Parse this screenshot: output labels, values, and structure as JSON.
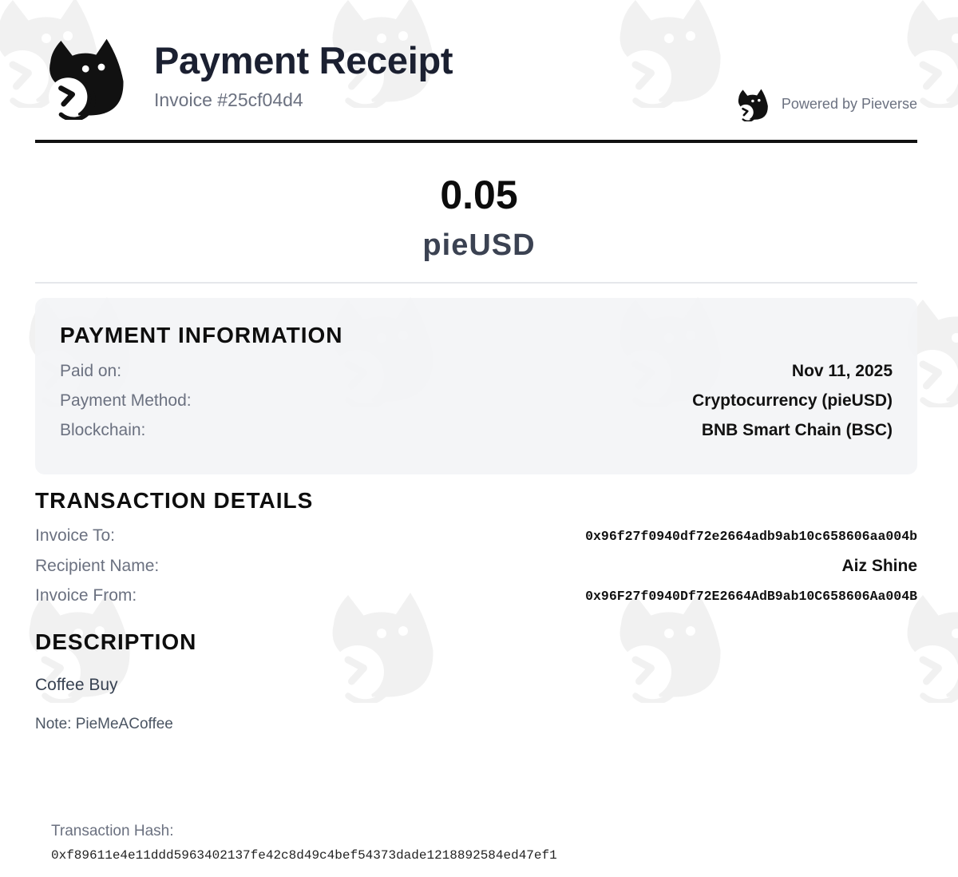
{
  "header": {
    "title": "Payment Receipt",
    "invoice_number": "Invoice #25cf04d4",
    "powered_by": "Powered by Pieverse"
  },
  "amount": {
    "value": "0.05",
    "currency": "pieUSD"
  },
  "payment_information": {
    "title": "PAYMENT INFORMATION",
    "rows": [
      {
        "label": "Paid on:",
        "value": "Nov 11, 2025"
      },
      {
        "label": "Payment Method:",
        "value": "Cryptocurrency (pieUSD)"
      },
      {
        "label": "Blockchain:",
        "value": "BNB Smart Chain (BSC)"
      }
    ]
  },
  "transaction_details": {
    "title": "TRANSACTION DETAILS",
    "rows": [
      {
        "label": "Invoice To:",
        "value": "0x96f27f0940df72e2664adb9ab10c658606aa004b"
      },
      {
        "label": "Recipient Name:",
        "value": "Aiz Shine"
      },
      {
        "label": "Invoice From:",
        "value": "0x96F27f0940Df72E2664AdB9ab10C658606Aa004B"
      }
    ]
  },
  "description": {
    "title": "DESCRIPTION",
    "text": "Coffee Buy",
    "note": "Note: PieMeACoffee"
  },
  "transaction_hash": {
    "label": "Transaction Hash:",
    "value": "0xf89611e4e11ddd5963402137fe42c8d49c4bef54373dade1218892584ed47ef1"
  },
  "icons": {
    "brand_logo": "pieverse-cat-logo-icon",
    "powered_logo": "pieverse-cat-logo-icon",
    "watermark": "pieverse-watermark-icon"
  },
  "colors": {
    "title": "#1b2031",
    "muted": "#6b7180",
    "card_background": "#f3f4f6",
    "rule": "#111111"
  }
}
